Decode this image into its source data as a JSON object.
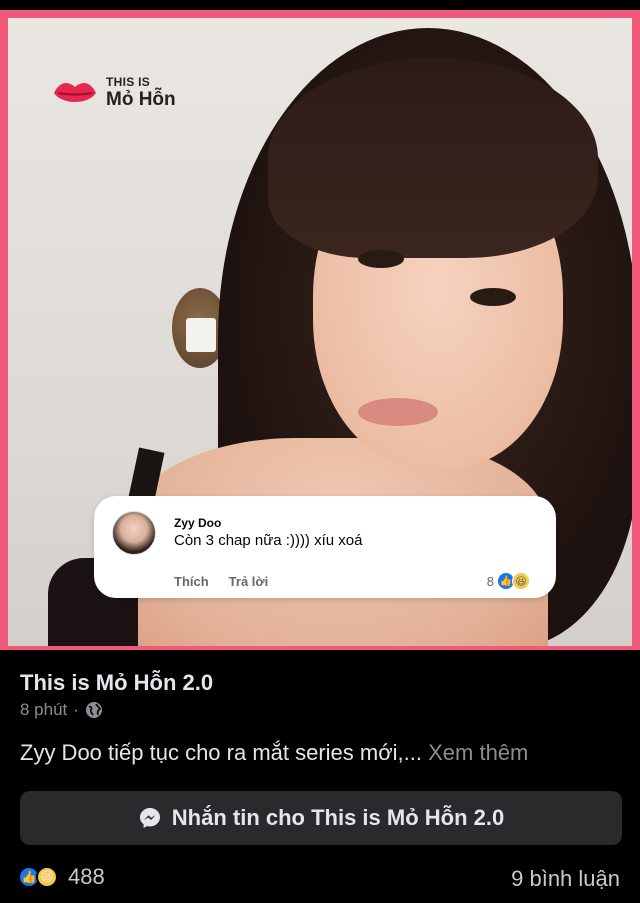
{
  "image_card": {
    "logo": {
      "line1": "THIS IS",
      "line2": "Mỏ Hỗn",
      "icon": "lips-icon"
    },
    "comment": {
      "author": "Zyy Doo",
      "text": "Còn 3 chap nữa :)))) xíu xoá",
      "actions": [
        "Thích",
        "Trả lời"
      ],
      "reaction_count": "8",
      "reactions": [
        "like-icon",
        "haha-icon"
      ]
    }
  },
  "post": {
    "page_name": "This is Mỏ Hỗn 2.0",
    "time": "8 phút",
    "privacy_icon": "globe-icon",
    "caption": "Zyy Doo tiếp tục cho ra mắt series mới,...",
    "see_more": "Xem thêm",
    "message_button": "Nhắn tin cho This is Mỏ Hỗn 2.0",
    "reaction_count": "488",
    "comments": "9 bình luận"
  },
  "colors": {
    "frame": "#f2587a",
    "like_blue": "#1877f2",
    "haha_yellow": "#f7c948",
    "background": "#000000"
  }
}
